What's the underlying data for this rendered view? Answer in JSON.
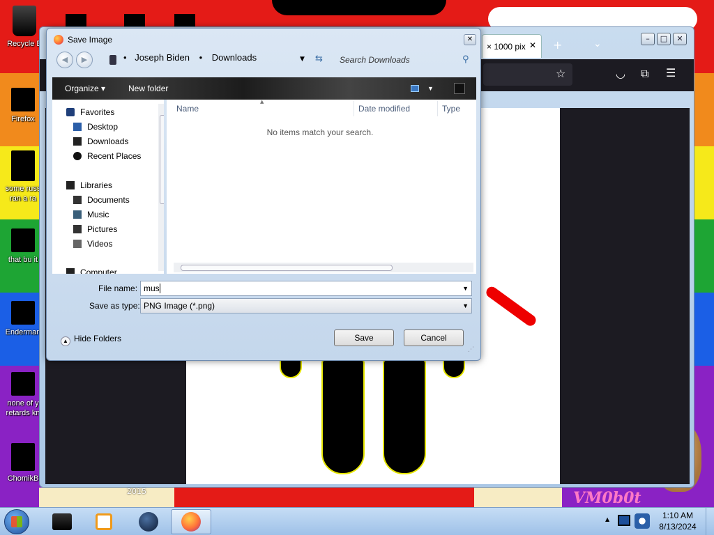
{
  "desktop": {
    "icons": [
      {
        "label": "Recycle B"
      },
      {
        "label": "Firefox"
      },
      {
        "label": "some russ"
      },
      {
        "label": "ran a ra"
      },
      {
        "label": "that bu it"
      },
      {
        "label": "Enderman"
      },
      {
        "label": "none of y"
      },
      {
        "label": "retards kn"
      },
      {
        "label": "ChomikB"
      }
    ],
    "year_label": "2015",
    "watermark": "VM0b0t"
  },
  "browser": {
    "tab_label": "× 1000 pix",
    "tab_close": "✕",
    "new_tab": "+",
    "tab_list": "⌄",
    "win_min": "–",
    "win_max": "□",
    "win_close": "✕"
  },
  "dialog": {
    "title": "Save Image",
    "close": "✕",
    "back": "◀",
    "forward": "▶",
    "breadcrumb": [
      "Joseph Biden",
      "Downloads"
    ],
    "search_placeholder": "Search Downloads",
    "toolbar": {
      "organize": "Organize ▾",
      "new_folder": "New folder"
    },
    "nav": {
      "favorites": "Favorites",
      "favorite_items": [
        "Desktop",
        "Downloads",
        "Recent Places"
      ],
      "libraries": "Libraries",
      "library_items": [
        "Documents",
        "Music",
        "Pictures",
        "Videos"
      ],
      "computer": "Computer"
    },
    "columns": {
      "name": "Name",
      "date": "Date modified",
      "type": "Type"
    },
    "empty_message": "No items match your search.",
    "file_name_label": "File name:",
    "file_name_value": "mus",
    "save_type_label": "Save as type:",
    "save_type_value": "PNG Image (*.png)",
    "hide_folders": "Hide Folders",
    "save_button": "Save",
    "cancel_button": "Cancel"
  },
  "taskbar": {
    "time": "1:10 AM",
    "date": "8/13/2024"
  },
  "colors": {
    "accent": "#1e73d2",
    "firefox": "#ff7139"
  }
}
